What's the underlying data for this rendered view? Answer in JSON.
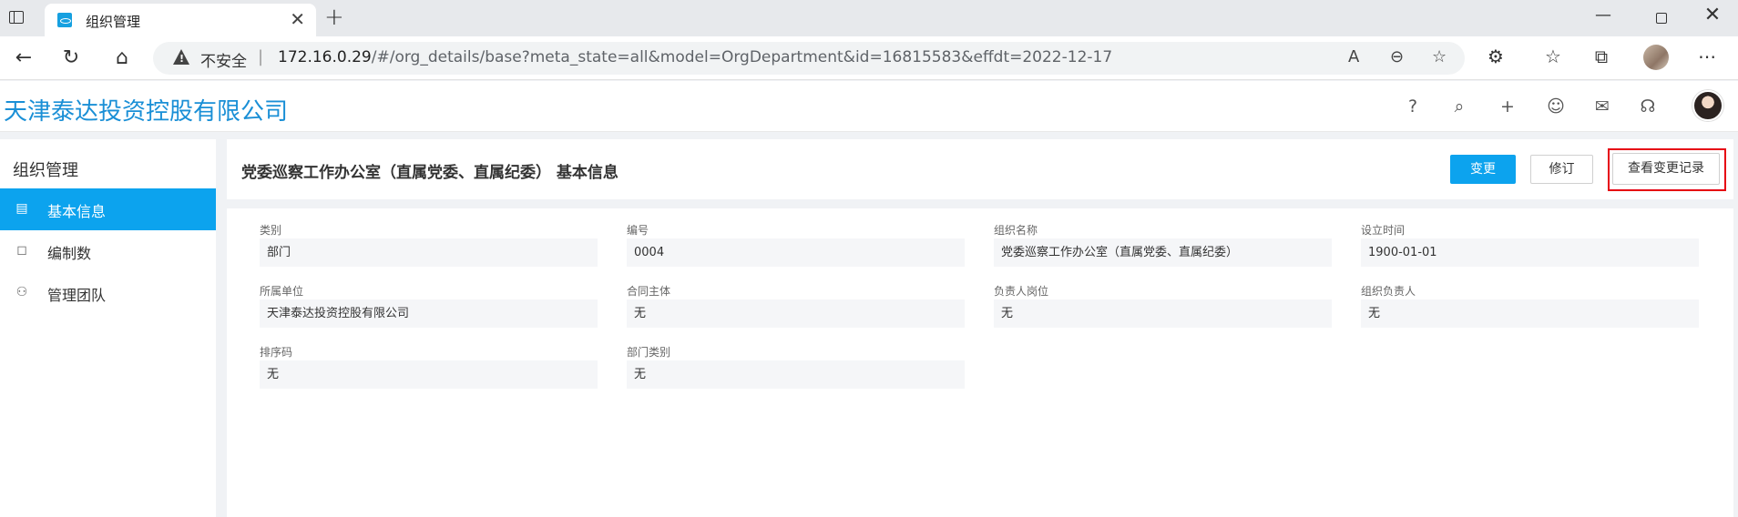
{
  "browser": {
    "tab_title": "组织管理",
    "tab_close": "✕",
    "new_tab": "+",
    "insecure_label": "不安全",
    "url_host": "172.16.0.29",
    "url_path": "/#/org_details/base?meta_state=all&model=OrgDepartment&id=16815583&effdt=2022-12-17"
  },
  "app": {
    "company": "天津泰达投资控股有限公司"
  },
  "sidebar": {
    "title": "组织管理",
    "items": [
      {
        "label": "基本信息",
        "icon": "document-icon",
        "active": true
      },
      {
        "label": "编制数",
        "icon": "bookmark-icon",
        "active": false
      },
      {
        "label": "管理团队",
        "icon": "team-icon",
        "active": false
      }
    ]
  },
  "page": {
    "title": "党委巡察工作办公室（直属党委、直属纪委） 基本信息",
    "buttons": {
      "change": "变更",
      "revise": "修订",
      "history": "查看变更记录"
    }
  },
  "fields": [
    {
      "label": "类别",
      "value": "部门"
    },
    {
      "label": "编号",
      "value": "0004"
    },
    {
      "label": "组织名称",
      "value": "党委巡察工作办公室（直属党委、直属纪委）"
    },
    {
      "label": "设立时间",
      "value": "1900-01-01"
    },
    {
      "label": "所属单位",
      "value": "天津泰达投资控股有限公司"
    },
    {
      "label": "合同主体",
      "value": "无"
    },
    {
      "label": "负责人岗位",
      "value": "无"
    },
    {
      "label": "组织负责人",
      "value": "无"
    },
    {
      "label": "排序码",
      "value": "无"
    },
    {
      "label": "部门类别",
      "value": "无"
    }
  ],
  "colors": {
    "accent": "#0ca3ee",
    "brand": "#1a8fd6",
    "highlight": "#e60012"
  }
}
